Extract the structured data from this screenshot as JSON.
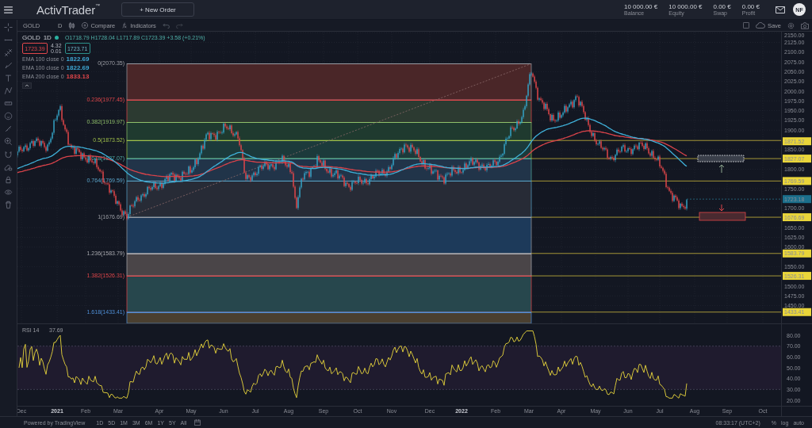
{
  "topbar": {
    "logo": "ActivTrader",
    "logo_mark": "™",
    "new_order": "+ New Order",
    "stats": [
      {
        "value": "10 000.00 €",
        "label": "Balance"
      },
      {
        "value": "10 000.00 €",
        "label": "Equity"
      },
      {
        "value": "0.00 €",
        "label": "Swap"
      },
      {
        "value": "0.00 €",
        "label": "Profit"
      }
    ],
    "avatar": "NF"
  },
  "toolbar": {
    "symbol": "GOLD",
    "interval": "D",
    "compare": "Compare",
    "indicators": "Indicators",
    "save": "Save"
  },
  "legend": {
    "symbol": "GOLD",
    "interval": "1D",
    "ohlc": "O1718.79 H1728.04 L1717.89 C1723.39 +3.58 (+0.21%)",
    "sell": "1723.39",
    "spread": "4.32",
    "lot": "0.01",
    "buy": "1723.71",
    "studies": [
      {
        "name": "EMA 100 close 0",
        "value": "1822.69",
        "color": "#3fa9d6"
      },
      {
        "name": "EMA 100 close 0",
        "value": "1822.69",
        "color": "#3fa9d6"
      },
      {
        "name": "EMA 200 close 0",
        "value": "1833.13",
        "color": "#e0464a"
      }
    ]
  },
  "fib_levels": [
    {
      "label": "0(2070.35)",
      "color": "#9a9ca3"
    },
    {
      "label": "0.236(1977.45)",
      "color": "#e0464a"
    },
    {
      "label": "0.382(1919.97)",
      "color": "#8fbf6a"
    },
    {
      "label": "0.5(1873.52)",
      "color": "#9fbf4a"
    },
    {
      "label": "0.618(1827.07)",
      "color": "#4fa8a0"
    },
    {
      "label": "0.764(1769.59)",
      "color": "#5aa3c8"
    },
    {
      "label": "1(1676.69)",
      "color": "#9a9ca3"
    },
    {
      "label": "1.236(1583.79)",
      "color": "#a8a9ae"
    },
    {
      "label": "1.382(1526.31)",
      "color": "#e0464a"
    },
    {
      "label": "1.618(1433.41)",
      "color": "#4f8fd6"
    }
  ],
  "price_axis": {
    "ticks": [
      "2150.00",
      "2125.00",
      "2100.00",
      "2075.00",
      "2050.00",
      "2025.00",
      "2000.00",
      "1975.00",
      "1950.00",
      "1925.00",
      "1900.00",
      "1850.00",
      "1800.00",
      "1750.00",
      "1700.00",
      "1650.00",
      "1625.00",
      "1600.00",
      "1550.00",
      "1500.00",
      "1475.00",
      "1450.00"
    ],
    "badges": [
      {
        "text": "1871.52",
        "kind": "level"
      },
      {
        "text": "1827.07",
        "kind": "level"
      },
      {
        "text": "1769.59",
        "kind": "level"
      },
      {
        "text": "1723.18",
        "kind": "current"
      },
      {
        "text": "1676.69",
        "kind": "level"
      },
      {
        "text": "1583.79",
        "kind": "level"
      },
      {
        "text": "1526.31",
        "kind": "level"
      },
      {
        "text": "1433.41",
        "kind": "level"
      }
    ]
  },
  "rsi": {
    "title": "RSI 14",
    "value": "37.69",
    "ticks": [
      "80.00",
      "70.00",
      "60.00",
      "50.00",
      "40.00",
      "30.00",
      "20.00"
    ]
  },
  "time_axis": [
    {
      "label": "Dec",
      "kind": "month"
    },
    {
      "label": "2021",
      "kind": "year"
    },
    {
      "label": "Feb",
      "kind": "month"
    },
    {
      "label": "Mar",
      "kind": "month"
    },
    {
      "label": "Apr",
      "kind": "month"
    },
    {
      "label": "May",
      "kind": "month"
    },
    {
      "label": "Jun",
      "kind": "month"
    },
    {
      "label": "Jul",
      "kind": "month"
    },
    {
      "label": "Aug",
      "kind": "month"
    },
    {
      "label": "Sep",
      "kind": "month"
    },
    {
      "label": "Oct",
      "kind": "month"
    },
    {
      "label": "Nov",
      "kind": "month"
    },
    {
      "label": "Dec",
      "kind": "month"
    },
    {
      "label": "2022",
      "kind": "year"
    },
    {
      "label": "Feb",
      "kind": "month"
    },
    {
      "label": "Mar",
      "kind": "month"
    },
    {
      "label": "Apr",
      "kind": "month"
    },
    {
      "label": "May",
      "kind": "month"
    },
    {
      "label": "Jun",
      "kind": "month"
    },
    {
      "label": "Jul",
      "kind": "month"
    },
    {
      "label": "Aug",
      "kind": "month"
    },
    {
      "label": "Sep",
      "kind": "month"
    },
    {
      "label": "Oct",
      "kind": "month"
    }
  ],
  "bottombar": {
    "powered": "Powered by TradingView",
    "timeframes": [
      "1D",
      "5D",
      "1M",
      "3M",
      "6M",
      "1Y",
      "5Y",
      "All"
    ],
    "clock": "08:33:17 (UTC+2)",
    "options": [
      "%",
      "log",
      "auto"
    ]
  }
}
